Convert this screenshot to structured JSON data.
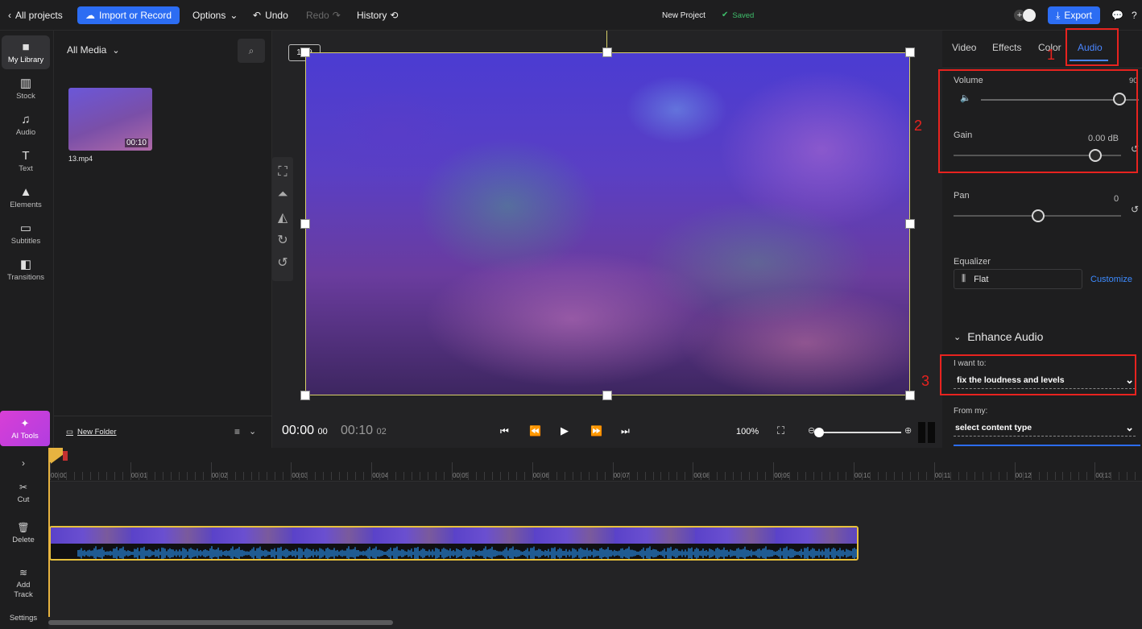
{
  "topbar": {
    "back_label": "All projects",
    "import_label": "Import or Record",
    "options_label": "Options",
    "undo_label": "Undo",
    "redo_label": "Redo",
    "history_label": "History",
    "project_name": "New Project",
    "saved_label": "Saved",
    "export_label": "Export"
  },
  "rail": {
    "items": [
      {
        "label": "My Library",
        "icon": "folder-icon"
      },
      {
        "label": "Stock",
        "icon": "stock-icon"
      },
      {
        "label": "Audio",
        "icon": "music-note-icon"
      },
      {
        "label": "Text",
        "icon": "text-icon"
      },
      {
        "label": "Elements",
        "icon": "shapes-icon"
      },
      {
        "label": "Subtitles",
        "icon": "subtitles-icon"
      },
      {
        "label": "Transitions",
        "icon": "transitions-icon"
      }
    ],
    "ai_label": "AI Tools"
  },
  "media": {
    "filter_label": "All Media",
    "file_name": "13.mp4",
    "file_duration": "00:10",
    "new_folder_label": "New Folder"
  },
  "preview": {
    "aspect_ratio": "16:9",
    "time_current": "00:00",
    "time_current_frames": "00",
    "time_total": "00:10",
    "time_total_frames": "02",
    "zoom": "100%"
  },
  "props": {
    "tabs": [
      "Video",
      "Effects",
      "Color",
      "Audio"
    ],
    "active_tab": "Audio",
    "volume_label": "Volume",
    "volume_value": "90",
    "volume_level": 0.9,
    "gain_label": "Gain",
    "gain_value": "0.00 dB",
    "pan_label": "Pan",
    "pan_value": "0",
    "equalizer_label": "Equalizer",
    "equalizer_value": "Flat",
    "customize_label": "Customize",
    "enhance_label": "Enhance Audio",
    "want_label": "I want to:",
    "want_value": "fix the loudness and levels",
    "from_label": "From my:",
    "from_value": "select content type",
    "annotations": [
      "1",
      "2",
      "3"
    ]
  },
  "timeline": {
    "buttons": [
      "Cut",
      "Delete",
      "Add Track",
      "Settings"
    ],
    "ticks": [
      "00:00",
      "00:01",
      "00:02",
      "00:03",
      "00:04",
      "00:05",
      "00:06",
      "00:07",
      "00:08",
      "00:09",
      "00:10",
      "00:11",
      "00:12",
      "00:13"
    ]
  },
  "colors": {
    "accent": "#2c6df3",
    "saved": "#3fbf6b",
    "annotation": "#e8231f",
    "clip_border": "#e7c13d",
    "waveform": "#2a8ee8"
  }
}
